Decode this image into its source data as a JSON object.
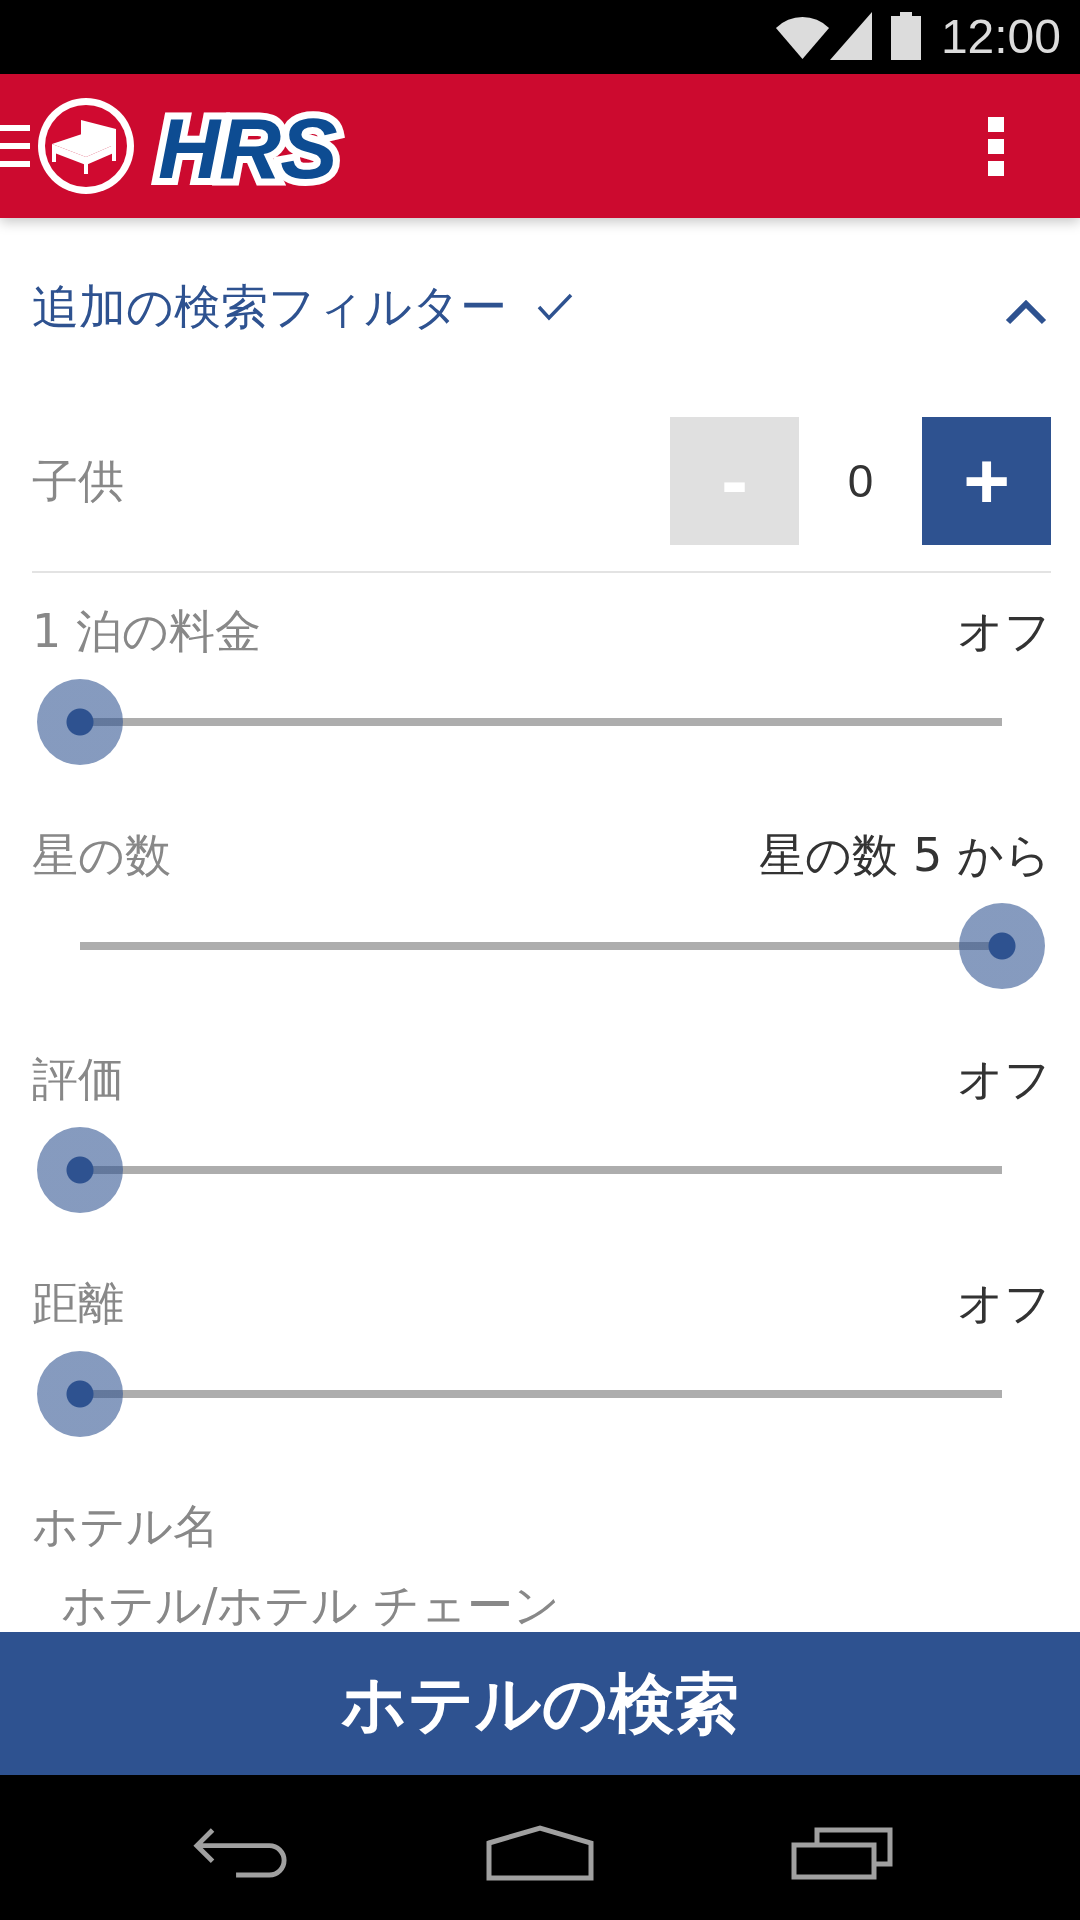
{
  "status_bar": {
    "time": "12:00"
  },
  "app_bar": {
    "logo_text": "HRS"
  },
  "filter_section": {
    "title": "追加の検索フィルター",
    "applied": true,
    "expanded": true
  },
  "children_count": {
    "label": "子供",
    "value": "0",
    "decrement": {
      "label": "-",
      "disabled": true
    },
    "increment": {
      "label": "+",
      "disabled": false
    }
  },
  "sliders": [
    {
      "label": "1 泊の料金",
      "reading": "オフ",
      "level": 0
    },
    {
      "label": "星の数",
      "reading": "星の数 5 から",
      "level": 1
    },
    {
      "label": "評価",
      "reading": "オフ",
      "level": 0
    },
    {
      "label": "距離",
      "reading": "オフ",
      "level": 0
    }
  ],
  "hotel_name": {
    "label": "ホテル名",
    "placeholder": "ホテル/ホテル チェーン"
  },
  "search_button": {
    "label": "ホテルの検索"
  }
}
